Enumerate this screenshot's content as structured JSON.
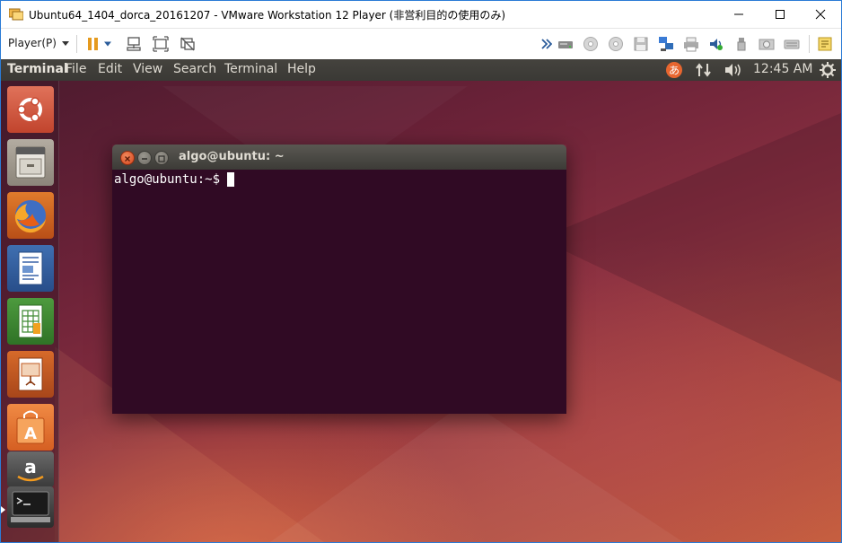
{
  "window": {
    "title": "Ubuntu64_1404_dorca_20161207 - VMware Workstation 12 Player (非営利目的の使用のみ)"
  },
  "toolbar": {
    "player_menu_label": "Player(P)",
    "icons": [
      "pause-icon",
      "dropdown-arrow-icon",
      "send-ctrl-alt-del-icon",
      "fit-guest-icon",
      "unity-mode-icon",
      "hidden-devices-icon",
      "hard-disk-icon",
      "cd-drive-icon",
      "cd-drive-icon",
      "floppy-icon",
      "network-icon",
      "printer-icon",
      "sound-icon",
      "usb-icon",
      "camera-icon",
      "keyboard-icon",
      "message-log-icon"
    ]
  },
  "ubuntu": {
    "panel": {
      "app_name": "Terminal",
      "menus": [
        "File",
        "Edit",
        "View",
        "Search",
        "Terminal",
        "Help"
      ],
      "clock": "12:45 AM",
      "indicators": [
        "input-method-icon",
        "network-arrows-icon",
        "volume-icon",
        "session-gear-icon"
      ]
    },
    "launcher": [
      "ubuntu-dash-icon",
      "files-icon",
      "firefox-icon",
      "libreoffice-writer-icon",
      "libreoffice-calc-icon",
      "libreoffice-impress-icon",
      "software-center-icon",
      "amazon-icon",
      "terminal-icon"
    ],
    "terminal": {
      "title": "algo@ubuntu: ~",
      "prompt": "algo@ubuntu:~$"
    }
  },
  "colors": {
    "vmware_accent": "#2b7bd6",
    "terminal_bg": "#300a24",
    "panel_bg": "#3c3b37",
    "close_button": "#e5512d"
  }
}
